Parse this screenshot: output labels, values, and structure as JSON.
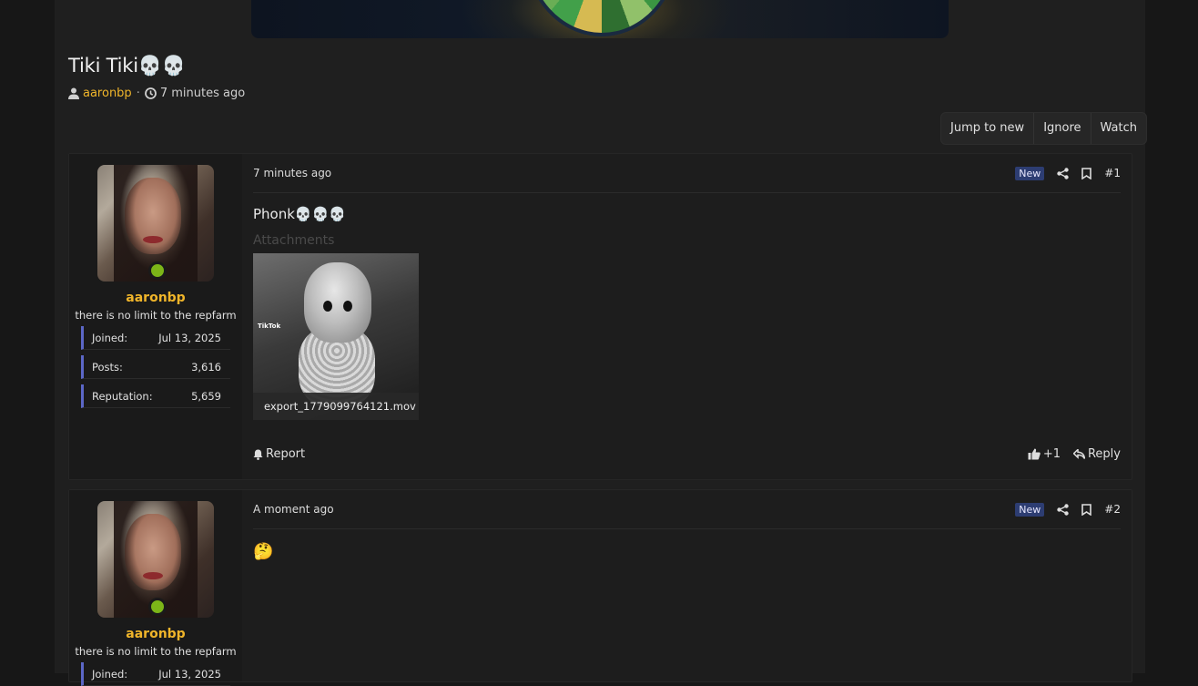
{
  "thread": {
    "title": "Tiki Tiki💀💀",
    "author": "aaronbp",
    "separator": "·",
    "time": "7 minutes ago"
  },
  "actions": {
    "jump": "Jump to new",
    "ignore": "Ignore",
    "watch": "Watch"
  },
  "posts": [
    {
      "time": "7 minutes ago",
      "badge": "New",
      "number": "#1",
      "user": {
        "name": "aaronbp",
        "title": "there is no limit to the repfarm",
        "joined_label": "Joined:",
        "joined": "Jul 13, 2025",
        "posts_label": "Posts:",
        "posts": "3,616",
        "rep_label": "Reputation:",
        "rep": "5,659"
      },
      "text": "Phonk💀💀💀",
      "attachments_label": "Attachments",
      "attachment_tiktok": "TikTok",
      "attachment_file": "export_1779099764121.mov",
      "report": "Report",
      "reaction": "+1",
      "reply": "Reply"
    },
    {
      "time": "A moment ago",
      "badge": "New",
      "number": "#2",
      "user": {
        "name": "aaronbp",
        "title": "there is no limit to the repfarm",
        "joined_label": "Joined:",
        "joined": "Jul 13, 2025"
      },
      "text": "🤔"
    }
  ]
}
